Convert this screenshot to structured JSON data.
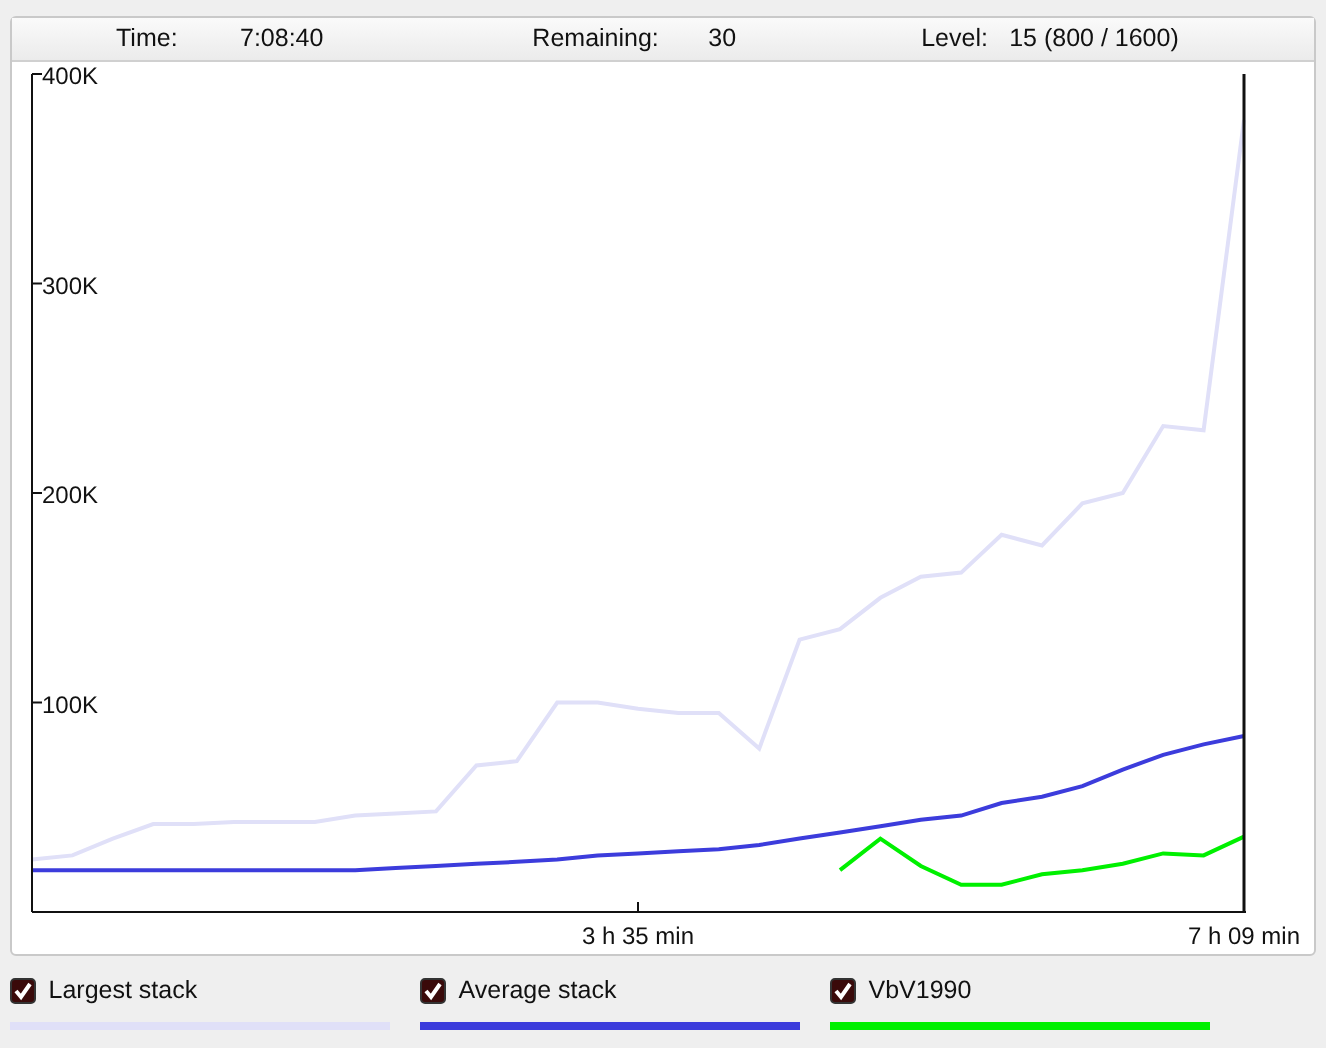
{
  "status": [
    {
      "label": "Time:",
      "value": "7:08:40"
    },
    {
      "label": "Remaining:",
      "value": "30"
    },
    {
      "label": "Level:",
      "value": "15 (800 / 1600)"
    }
  ],
  "chart": {
    "chart_data": {
      "type": "line",
      "categories": [
        null,
        null,
        null,
        null,
        null,
        null,
        null,
        null,
        null,
        null,
        null,
        null,
        null,
        null,
        null,
        "3 h 35 min",
        null,
        null,
        null,
        null,
        null,
        null,
        null,
        null,
        null,
        null,
        null,
        null,
        null,
        null,
        "7 h 09 min"
      ],
      "series": [
        {
          "name": "Largest stack",
          "color": "#e0e0f8",
          "values": [
            25,
            27,
            35,
            42,
            42,
            43,
            43,
            43,
            46,
            47,
            48,
            70,
            72,
            100,
            100,
            97,
            95,
            95,
            78,
            130,
            135,
            150,
            160,
            162,
            180,
            175,
            195,
            200,
            232,
            230,
            378
          ]
        },
        {
          "name": "Average stack",
          "color": "#3c3cdc",
          "values": [
            20,
            20,
            20,
            20,
            20,
            20,
            20,
            20,
            20,
            21,
            22,
            23,
            24,
            25,
            27,
            28,
            29,
            30,
            32,
            35,
            38,
            41,
            44,
            46,
            52,
            55,
            60,
            68,
            75,
            80,
            84
          ]
        },
        {
          "name": "VbV1990",
          "color": "#00f000",
          "values": [
            null,
            null,
            null,
            null,
            null,
            null,
            null,
            null,
            null,
            null,
            null,
            null,
            null,
            null,
            null,
            null,
            null,
            null,
            null,
            null,
            20,
            35,
            22,
            13,
            13,
            18,
            20,
            23,
            28,
            27,
            36
          ]
        }
      ],
      "ylim": [
        0,
        400
      ],
      "yticks": [
        {
          "value": 100,
          "label": "100K"
        },
        {
          "value": 200,
          "label": "200K"
        },
        {
          "value": 300,
          "label": "300K"
        },
        {
          "value": 400,
          "label": "400K"
        }
      ]
    }
  },
  "legend": [
    {
      "checked": true
    },
    {
      "checked": true
    },
    {
      "checked": true
    }
  ]
}
